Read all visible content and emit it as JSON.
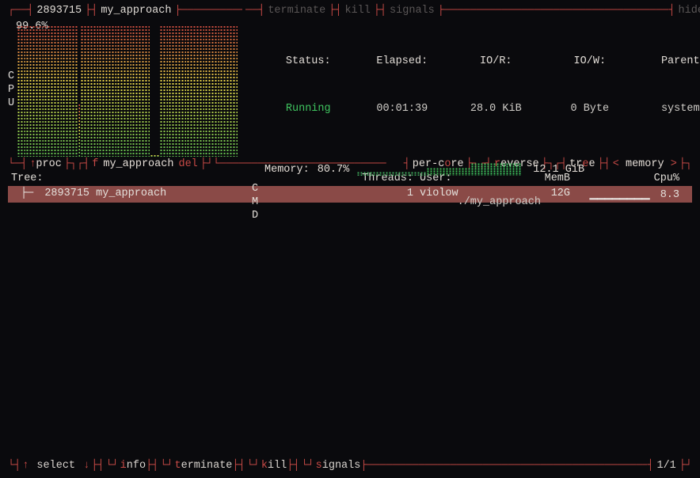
{
  "top": {
    "pid": "2893715",
    "proc_name": "my_approach",
    "cpu_pct": "99.6%",
    "cpu_label": [
      "C",
      "P",
      "U"
    ],
    "info_bar_actions": {
      "terminate": "terminate",
      "kill": "kill",
      "signals": "signals",
      "hide": "hide"
    },
    "status": {
      "label": "Status:",
      "value": "Running"
    },
    "elapsed": {
      "label": "Elapsed:",
      "value": "00:01:39"
    },
    "io_r": {
      "label": "IO/R:",
      "value": "28.0 KiB"
    },
    "io_w": {
      "label": "IO/W:",
      "value": "0 Byte"
    },
    "parent": {
      "label": "Parent:",
      "value": "systemd"
    },
    "memory": {
      "label": "Memory:",
      "pct": "80.7%",
      "value": "12.1 GiB"
    },
    "cmd_label": [
      "C",
      "M",
      "D"
    ],
    "cmd_value": "./my_approach"
  },
  "mid": {
    "lbl_proc": "proc",
    "lbl_f": "f",
    "filter_text": "my_approach",
    "lbl_del": "del",
    "lbl_percore": {
      "pre": "per-c",
      "hot": "o",
      "post": "re"
    },
    "lbl_reverse": {
      "pre": "",
      "hot": "r",
      "post": "everse"
    },
    "lbl_tree": {
      "pre": "tr",
      "hot": "e",
      "post": "e"
    },
    "sort_col": "memory",
    "headers": {
      "tree": "Tree:",
      "threads": "Threads:",
      "user": "User:",
      "memb": "MemB",
      "cpu": "Cpu%"
    },
    "rows": [
      {
        "pid": "2893715",
        "name": "my_approach",
        "threads": "1",
        "user": "violow",
        "memb": "12G",
        "cpu": "8.3"
      }
    ]
  },
  "footer": {
    "items": [
      {
        "glyph": "↑",
        "text": "select"
      },
      {
        "glyph": "↓",
        "text": ""
      },
      {
        "glyph": "└┘",
        "hot": "i",
        "text": "nfo"
      },
      {
        "glyph": "└┘",
        "hot": "t",
        "text": "erminate"
      },
      {
        "glyph": "└┘",
        "hot": "k",
        "text": "ill"
      },
      {
        "glyph": "└┘",
        "hot": "s",
        "text": "ignals"
      }
    ],
    "page": "1/1"
  },
  "chart_data": {
    "type": "bar",
    "title": "CPU %",
    "ylim": [
      0,
      100
    ],
    "values": [
      99,
      99,
      99,
      99,
      99,
      99,
      99,
      99,
      99,
      99,
      99,
      99,
      99,
      99,
      99,
      99,
      99,
      99,
      99,
      99,
      40,
      99,
      99,
      99,
      99,
      99,
      99,
      99,
      99,
      99,
      99,
      99,
      99,
      99,
      99,
      99,
      99,
      99,
      99,
      99,
      99,
      99,
      99,
      99,
      2,
      2,
      2,
      99,
      99,
      99,
      99,
      99,
      99,
      99,
      99,
      99,
      99,
      99,
      99,
      99,
      99,
      99,
      99,
      99,
      99,
      99,
      99,
      99,
      99,
      99,
      99,
      99,
      99
    ]
  }
}
